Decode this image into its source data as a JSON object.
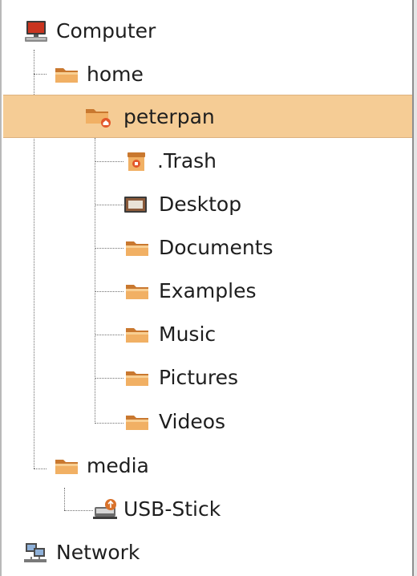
{
  "tree": {
    "computer": {
      "label": "Computer",
      "icon": "computer-icon"
    },
    "home": {
      "label": "home",
      "icon": "folder-icon"
    },
    "peterpan": {
      "label": "peterpan",
      "icon": "home-folder-icon",
      "selected": true
    },
    "trash": {
      "label": ".Trash",
      "icon": "trash-icon"
    },
    "desktop": {
      "label": "Desktop",
      "icon": "desktop-icon"
    },
    "documents": {
      "label": "Documents",
      "icon": "folder-icon"
    },
    "examples": {
      "label": "Examples",
      "icon": "folder-icon"
    },
    "music": {
      "label": "Music",
      "icon": "folder-icon"
    },
    "pictures": {
      "label": "Pictures",
      "icon": "folder-icon"
    },
    "videos": {
      "label": "Videos",
      "icon": "folder-icon"
    },
    "media": {
      "label": "media",
      "icon": "folder-icon"
    },
    "usb": {
      "label": "USB-Stick",
      "icon": "usb-drive-icon"
    },
    "network": {
      "label": "Network",
      "icon": "network-icon"
    }
  },
  "colors": {
    "selection": "#f5cc95",
    "folder": "#eaa15a",
    "text": "#1e1e1e"
  }
}
